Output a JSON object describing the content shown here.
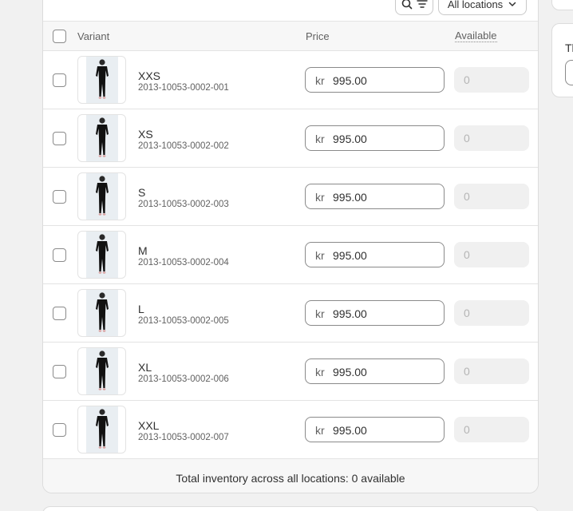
{
  "toolbar": {
    "search_icon": "search-icon",
    "filter_icon": "filter-sort-icon",
    "location_label": "All locations",
    "location_icon": "chevron-down-icon"
  },
  "table": {
    "columns": {
      "variant": "Variant",
      "price": "Price",
      "available": "Available"
    },
    "rows": [
      {
        "name": "XXS",
        "sku": "2013-10053-0002-001",
        "currency": "kr",
        "price": "995.00",
        "available": "0"
      },
      {
        "name": "XS",
        "sku": "2013-10053-0002-002",
        "currency": "kr",
        "price": "995.00",
        "available": "0"
      },
      {
        "name": "S",
        "sku": "2013-10053-0002-003",
        "currency": "kr",
        "price": "995.00",
        "available": "0"
      },
      {
        "name": "M",
        "sku": "2013-10053-0002-004",
        "currency": "kr",
        "price": "995.00",
        "available": "0"
      },
      {
        "name": "L",
        "sku": "2013-10053-0002-005",
        "currency": "kr",
        "price": "995.00",
        "available": "0"
      },
      {
        "name": "XL",
        "sku": "2013-10053-0002-006",
        "currency": "kr",
        "price": "995.00",
        "available": "0"
      },
      {
        "name": "XXL",
        "sku": "2013-10053-0002-007",
        "currency": "kr",
        "price": "995.00",
        "available": "0"
      }
    ],
    "footer": "Total inventory across all locations: 0 available"
  },
  "side": {
    "label": "Th"
  },
  "colors": {
    "background": "#f1f1f1",
    "card": "#ffffff",
    "border": "#e3e3e3",
    "text": "#303030",
    "muted": "#616161"
  }
}
